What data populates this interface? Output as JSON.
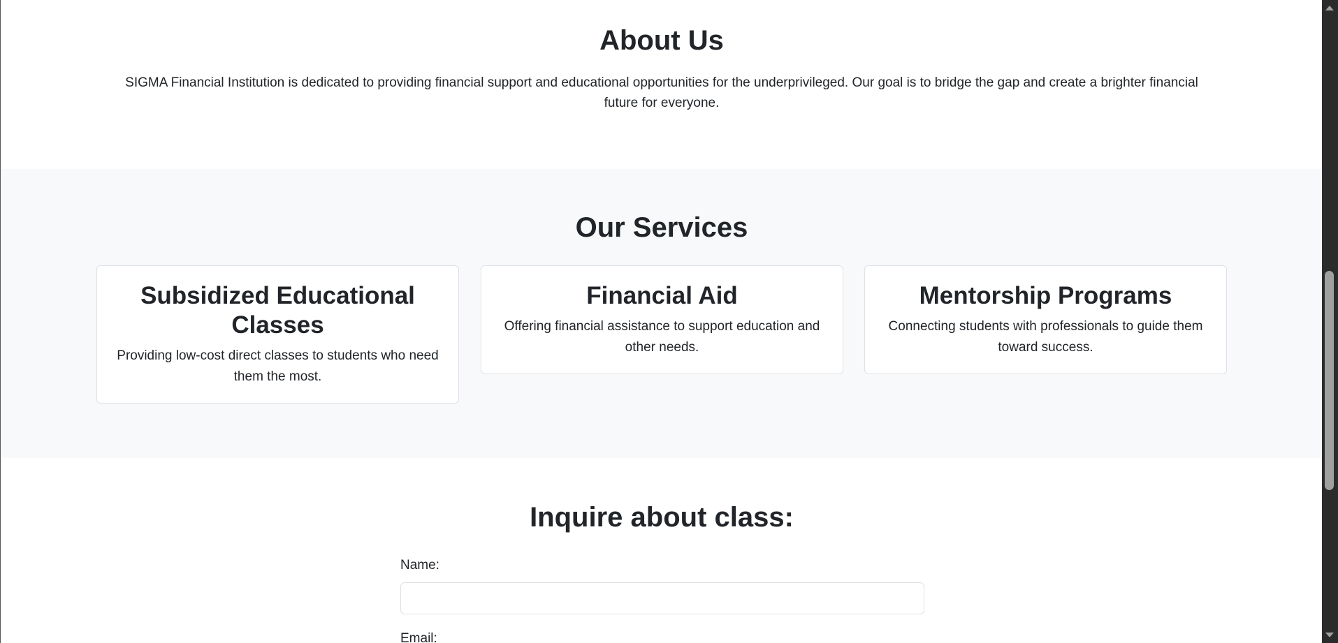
{
  "about": {
    "title": "About Us",
    "text": "SIGMA Financial Institution is dedicated to providing financial support and educational opportunities for the underprivileged. Our goal is to bridge the gap and create a brighter financial future for everyone."
  },
  "services": {
    "title": "Our Services",
    "cards": [
      {
        "title": "Subsidized Educational Classes",
        "text": "Providing low-cost direct classes to students who need them the most."
      },
      {
        "title": "Financial Aid",
        "text": "Offering financial assistance to support education and other needs."
      },
      {
        "title": "Mentorship Programs",
        "text": "Connecting students with professionals to guide them toward success."
      }
    ]
  },
  "inquire": {
    "title": "Inquire about class:",
    "name_label": "Name:",
    "name_value": "",
    "email_label": "Email:"
  }
}
